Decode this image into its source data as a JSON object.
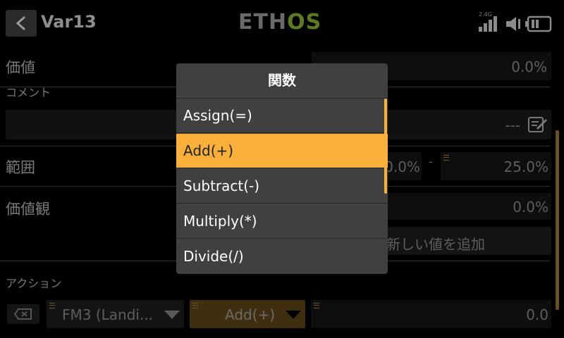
{
  "header": {
    "title": "Var13",
    "logo_left": "ETH",
    "logo_right": "OS",
    "signal_label": "2.4G"
  },
  "form": {
    "value_label": "価値",
    "value_value": "0.0%",
    "comment_label": "コメント",
    "comment_value": "---",
    "range_label": "範囲",
    "range_min": "0.0%",
    "range_sep": "-",
    "range_max": "25.0%",
    "values_label": "価値観",
    "values_value": "0.0%",
    "add_value_label": "新しい値を追加",
    "actions_label": "アクション",
    "action_source": "FM3 (Landi...",
    "action_function": "Add(+)",
    "action_value": "0.0"
  },
  "menu": {
    "title": "関数",
    "items": [
      "Assign(=)",
      "Add(+)",
      "Subtract(-)",
      "Multiply(*)",
      "Divide(/)"
    ],
    "selected_index": 1
  },
  "colors": {
    "accent": "#f8b03a",
    "logo_green": "#5e7a20"
  }
}
